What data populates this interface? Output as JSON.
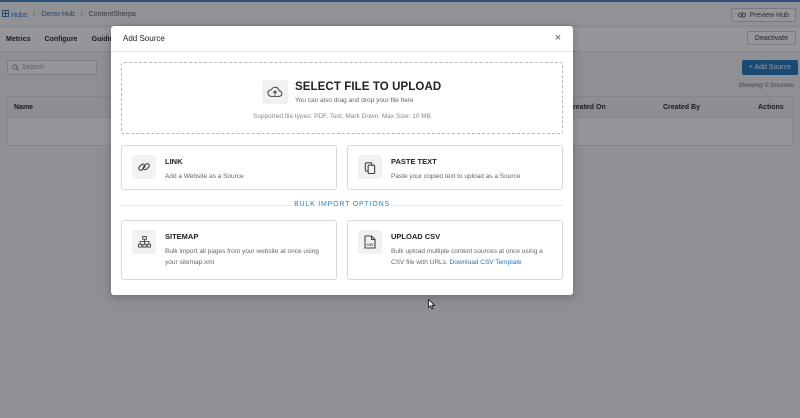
{
  "breadcrumb": {
    "items": [
      "Hubs",
      "Demo Hub",
      "ContentSherpa"
    ],
    "separator": "/"
  },
  "topbar": {
    "preview_label": "Preview Hub"
  },
  "nav": {
    "tabs": [
      "Metrics",
      "Configure",
      "Guiding"
    ],
    "deactivate_label": "Deactivate"
  },
  "toolbar": {
    "search_placeholder": "Search",
    "add_source_label": "+ Add Source",
    "showing_text": "Showing 0 Sources"
  },
  "table": {
    "columns": [
      "Name",
      "Created On",
      "Created By",
      "Actions"
    ]
  },
  "modal": {
    "title": "Add Source",
    "close_glyph": "×",
    "upload": {
      "title": "SELECT FILE TO UPLOAD",
      "subtitle": "You can also drag and drop your file here",
      "types": "Supported file types: PDF, Text, Mark Down. Max Size: 10 MB"
    },
    "link": {
      "title": "LINK",
      "desc": "Add a Website as a Source"
    },
    "paste": {
      "title": "PASTE TEXT",
      "desc": "Paste your copied text to upload as a Source"
    },
    "bulk_heading": "BULK IMPORT OPTIONS",
    "sitemap": {
      "title": "SITEMAP",
      "desc": "Bulk import all pages from your website at once using your sitemap.xml"
    },
    "csv": {
      "title": "UPLOAD CSV",
      "desc": "Bulk upload multiple content sources at once using a CSV file with URLs.",
      "link_label": "Download CSV Template"
    }
  },
  "colors": {
    "accent": "#1e73be",
    "bulk_heading": "#2a7fc7",
    "overlay": "#14161c"
  },
  "icons": [
    "hub-icon",
    "eye-icon",
    "search-icon",
    "close-icon",
    "cloud-upload-icon",
    "link-icon",
    "clipboard-icon",
    "sitemap-icon",
    "csv-file-icon",
    "mouse-cursor-icon"
  ]
}
